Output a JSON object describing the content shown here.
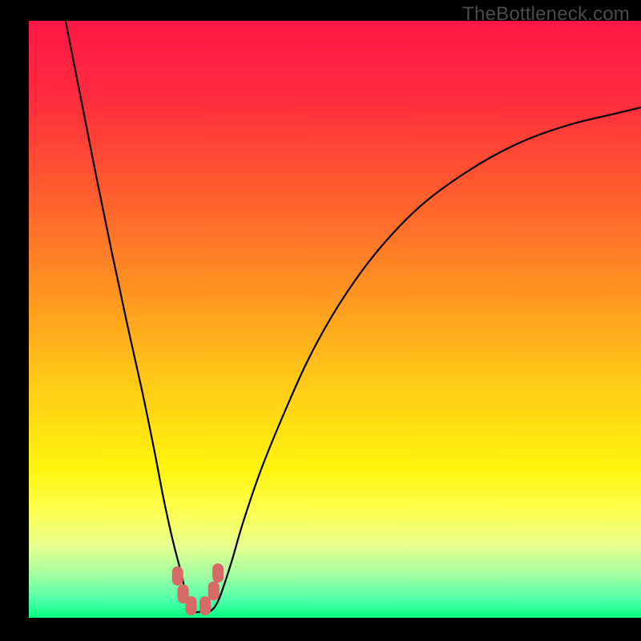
{
  "watermark": "TheBottleneck.com",
  "chart_data": {
    "type": "line",
    "title": "",
    "xlabel": "",
    "ylabel": "",
    "xlim": [
      0,
      100
    ],
    "ylim": [
      0,
      100
    ],
    "grid": false,
    "legend": false,
    "gradient_stops": [
      {
        "offset": 0.0,
        "color": "#ff1746"
      },
      {
        "offset": 0.13,
        "color": "#ff2c3e"
      },
      {
        "offset": 0.28,
        "color": "#ff5a2f"
      },
      {
        "offset": 0.44,
        "color": "#ff8f22"
      },
      {
        "offset": 0.6,
        "color": "#ffc817"
      },
      {
        "offset": 0.75,
        "color": "#fff40d"
      },
      {
        "offset": 0.82,
        "color": "#fdff4f"
      },
      {
        "offset": 0.88,
        "color": "#e7ff8e"
      },
      {
        "offset": 0.93,
        "color": "#9fffa2"
      },
      {
        "offset": 0.97,
        "color": "#4fffaa"
      },
      {
        "offset": 1.0,
        "color": "#03ff7f"
      }
    ],
    "series": [
      {
        "name": "bottleneck-curve",
        "x": [
          6.0,
          8.5,
          11.0,
          13.5,
          16.0,
          18.5,
          20.5,
          22.0,
          23.5,
          25.0,
          26.0,
          27.0,
          28.0,
          29.5,
          31.0,
          33.0,
          35.0,
          38.0,
          42.0,
          46.0,
          51.0,
          57.0,
          64.0,
          72.0,
          80.0,
          88.0,
          96.0,
          100.0
        ],
        "y": [
          100.0,
          87.0,
          74.0,
          61.5,
          49.5,
          38.0,
          28.0,
          20.0,
          13.0,
          7.0,
          2.2,
          1.0,
          1.0,
          1.0,
          3.0,
          9.0,
          16.0,
          25.0,
          35.0,
          44.0,
          53.0,
          61.5,
          69.0,
          75.0,
          79.5,
          82.5,
          84.5,
          85.5
        ]
      }
    ],
    "marker_points": {
      "name": "valley-markers",
      "color": "#d76a66",
      "x": [
        24.3,
        25.2,
        26.5,
        28.8,
        30.2,
        30.9
      ],
      "y": [
        7.0,
        4.0,
        2.0,
        2.0,
        4.5,
        7.5
      ]
    }
  }
}
